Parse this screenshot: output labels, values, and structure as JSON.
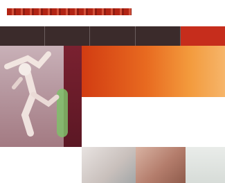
{
  "header": {
    "brand_text": "",
    "brand_color": "#b22414"
  },
  "nav": {
    "items": [
      {
        "label": "",
        "active": false
      },
      {
        "label": "",
        "active": false
      },
      {
        "label": "",
        "active": false
      },
      {
        "label": "",
        "active": false
      },
      {
        "label": "",
        "active": true
      }
    ],
    "background": "#3b2b2b",
    "active_color": "#c62d1c"
  },
  "hero": {
    "headline_lines": [
      "",
      "",
      ""
    ],
    "gradient_colors": [
      "#d23c12",
      "#e86a20",
      "#f39a3c",
      "#f6b56a"
    ]
  },
  "footer": {
    "logo_text": "",
    "logo_color": "#c62d1c"
  },
  "icons": {
    "logo": "brand-logo-icon",
    "figure": "human-figure-image"
  }
}
